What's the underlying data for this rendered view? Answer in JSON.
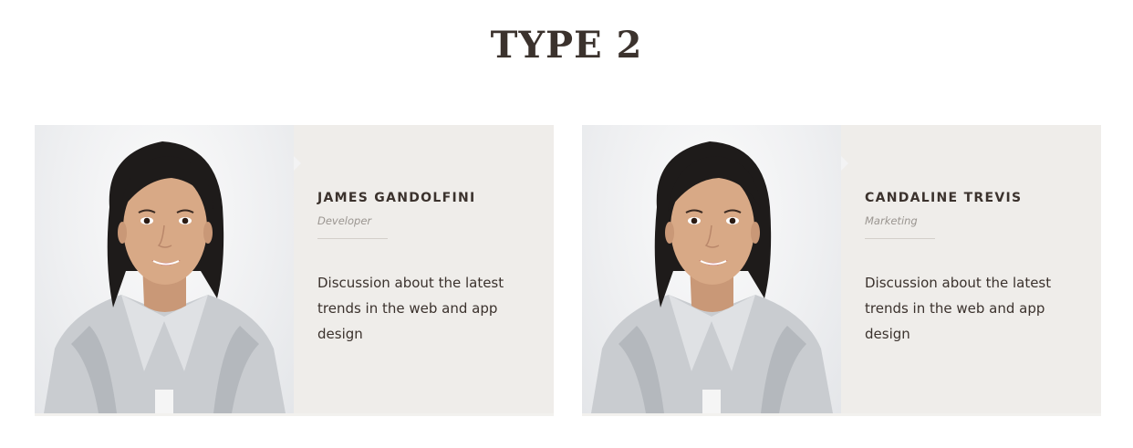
{
  "section": {
    "title": "TYPE 2"
  },
  "team": [
    {
      "name": "JAMES GANDOLFINI",
      "role": "Developer",
      "description": "Discussion about the latest trends in the web and app design"
    },
    {
      "name": "CANDALINE TREVIS",
      "role": "Marketing",
      "description": "Discussion about the latest trends in the web and app design"
    }
  ],
  "colors": {
    "heading": "#3b322d",
    "card_background": "#efedea",
    "role_text": "#9a9590",
    "divider": "#d3cfca"
  }
}
